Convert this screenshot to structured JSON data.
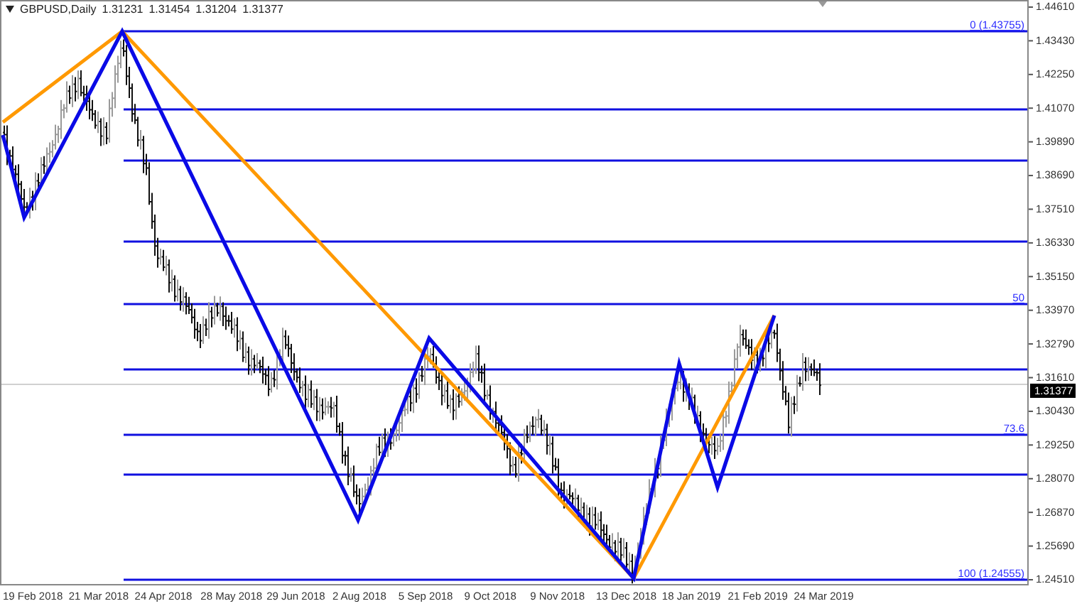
{
  "header": {
    "symbol": "GBPUSD,Daily",
    "quotes": [
      "1.31231",
      "1.31454",
      "1.31204",
      "1.31377"
    ]
  },
  "fib_labels": [
    "0 (1.43755)",
    "50",
    "73.6",
    "100 (1.24555)"
  ],
  "price_axis": [
    "1.44610",
    "1.43430",
    "1.42250",
    "1.41070",
    "1.39890",
    "1.38690",
    "1.37510",
    "1.36330",
    "1.35150",
    "1.33970",
    "1.32790",
    "1.31610",
    "1.30430",
    "1.29250",
    "1.28070",
    "1.26870",
    "1.25690",
    "1.24510"
  ],
  "current_price": "1.31377",
  "time_axis": [
    "19 Feb 2018",
    "21 Mar 2018",
    "24 Apr 2018",
    "28 May 2018",
    "29 Jun 2018",
    "2 Aug 2018",
    "5 Sep 2018",
    "9 Oct 2018",
    "9 Nov 2018",
    "13 Dec 2018",
    "18 Jan 2019",
    "21 Feb 2019",
    "24 Mar 2019"
  ]
}
